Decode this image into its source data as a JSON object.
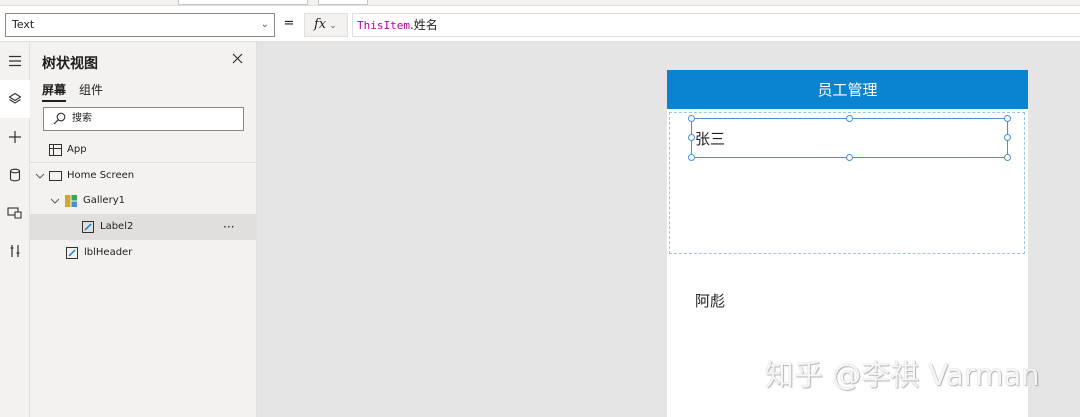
{
  "formula_bar": {
    "property": "Text",
    "equals": "=",
    "fx_label": "fx",
    "formula_keyword": "ThisItem",
    "formula_field": ".姓名"
  },
  "rail": {
    "icons": [
      "hamburger-icon",
      "layers-icon",
      "plus-icon",
      "database-icon",
      "media-icon",
      "tools-icon"
    ],
    "active_index": 1
  },
  "tree_view": {
    "title": "树状视图",
    "tabs": {
      "screens": "屏幕",
      "components": "组件"
    },
    "search_placeholder": "搜索",
    "app_item": "App",
    "items": [
      {
        "label": "Home Screen",
        "icon": "screen-icon",
        "expanded": true
      },
      {
        "label": "Gallery1",
        "icon": "gallery-icon",
        "expanded": true
      },
      {
        "label": "Label2",
        "icon": "label-icon",
        "selected": true,
        "more": "···"
      },
      {
        "label": "lblHeader",
        "icon": "label-icon"
      }
    ]
  },
  "canvas": {
    "header_text": "员工管理",
    "gallery_items": [
      "张三",
      "阿彪"
    ]
  },
  "watermark": "知乎 @李祺 Varman",
  "colors": {
    "header_blue": "#0a84d0",
    "selection_blue": "#4a90d9",
    "canvas_bg": "#e5e5e5",
    "panel_bg": "#f3f2f1",
    "formula_keyword": "#b4009e"
  }
}
